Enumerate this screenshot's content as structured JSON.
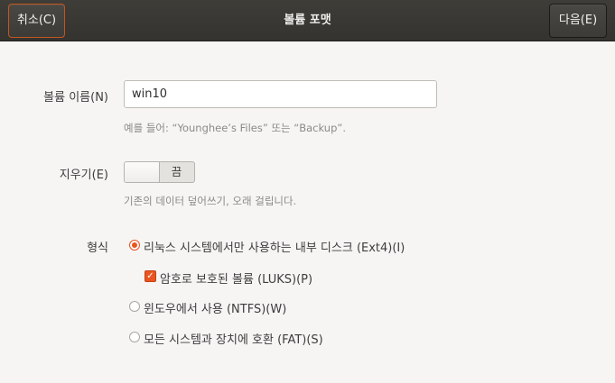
{
  "header": {
    "cancel_label": "취소(C)",
    "title": "볼륨 포맷",
    "next_label": "다음(E)"
  },
  "volume_name": {
    "label": "볼륨 이름(N)",
    "value": "win10",
    "hint": "예를 들어: “Younghee’s Files” 또는 “Backup”."
  },
  "erase": {
    "label": "지우기(E)",
    "switch_state": "끔",
    "hint": "기존의 데이터 덮어쓰기, 오래 걸립니다."
  },
  "format": {
    "label": "형식",
    "options": [
      {
        "label": "리눅스 시스템에서만 사용하는 내부 디스크 (Ext4)(I)",
        "selected": true
      },
      {
        "label": "윈도우에서 사용 (NTFS)(W)",
        "selected": false
      },
      {
        "label": "모든 시스템과 장치에 호환 (FAT)(S)",
        "selected": false
      }
    ],
    "encrypt": {
      "label": "암호로 보호된 볼륨 (LUKS)(P)",
      "checked": true
    }
  },
  "colors": {
    "accent": "#e95420",
    "headerbar": "#3b3935"
  }
}
